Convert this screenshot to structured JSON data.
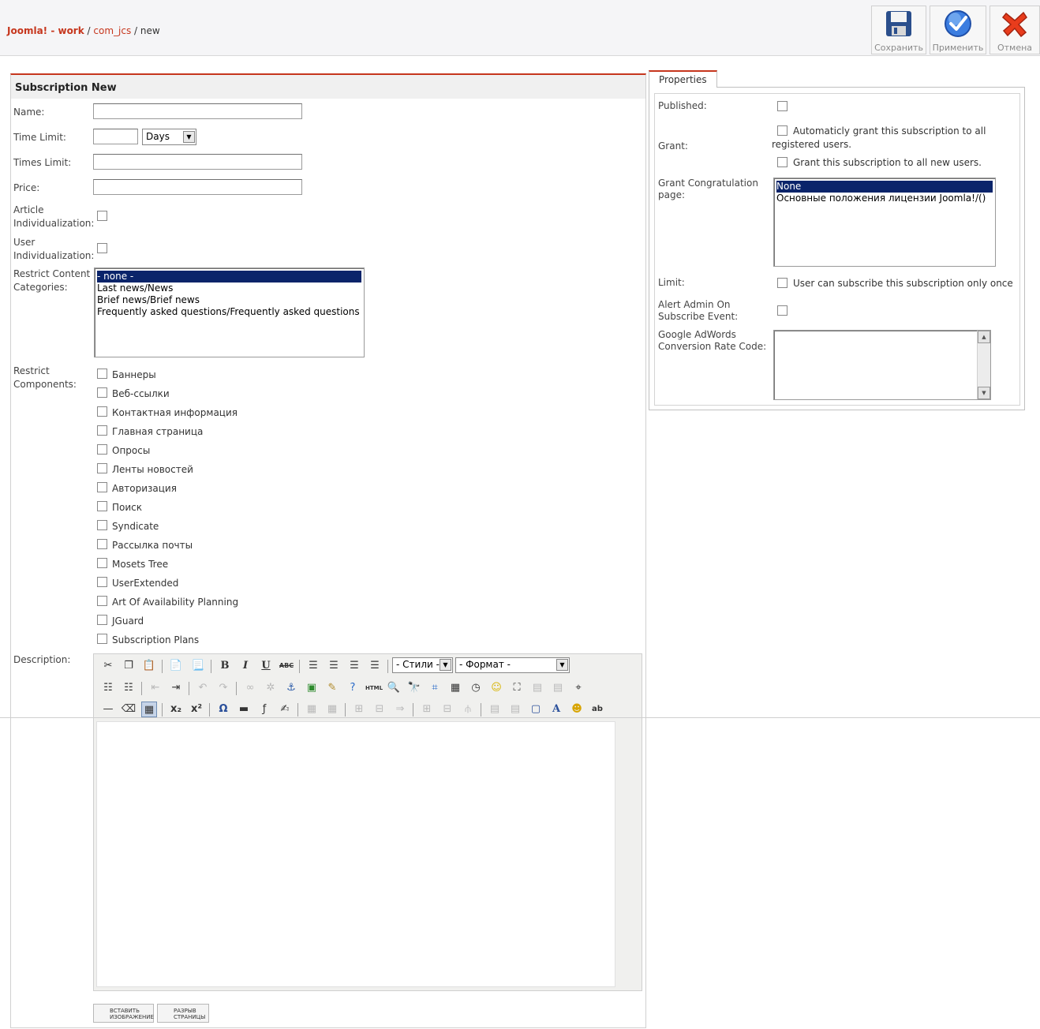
{
  "header": {
    "breadcrumb": {
      "site": "Joomla! - work",
      "sep1": " / ",
      "component": "com_jcs",
      "sep2": " / ",
      "page": "new"
    },
    "buttons": {
      "save": "Сохранить",
      "apply": "Применить",
      "cancel": "Отмена"
    }
  },
  "form": {
    "title": "Subscription New",
    "labels": {
      "name": "Name:",
      "time_limit": "Time Limit:",
      "times_limit": "Times Limit:",
      "price": "Price:",
      "article_ind": "Article Individualization:",
      "user_ind": "User Individualization:",
      "restrict_categories": "Restrict Content Categories:",
      "restrict_components": "Restrict Components:",
      "description": "Description:"
    },
    "time_unit": "Days",
    "categories": [
      "- none -",
      "Last news/News",
      "Brief news/Brief news",
      "Frequently asked questions/Frequently asked questions"
    ],
    "components": [
      "Баннеры",
      "Веб-ссылки",
      "Контактная информация",
      "Главная страница",
      "Опросы",
      "Ленты новостей",
      "Авторизация",
      "Поиск",
      "Syndicate",
      "Рассылка почты",
      "Mosets Tree",
      "UserExtended",
      "Art Of Availability Planning",
      "JGuard",
      "Subscription Plans"
    ],
    "editor": {
      "styles_select": "- Стили -",
      "format_select": "- Формат -",
      "html_label": "HTML",
      "insert_image": "ВСТАВИТЬ ИЗОБРАЖЕНИЕ",
      "page_break": "РАЗРЫВ СТРАНИЦЫ"
    }
  },
  "properties": {
    "tab": "Properties",
    "labels": {
      "published": "Published:",
      "grant": "Grant:",
      "congrats": "Grant Congratulation page:",
      "limit": "Limit:",
      "alert": "Alert Admin On Subscribe Event:",
      "adwords": "Google AdWords Conversion Rate Code:"
    },
    "grant_options": {
      "all_registered": "Automaticly grant this subscription to all registered users.",
      "all_new": "Grant this subscription to all new users."
    },
    "congrats_options": [
      "None",
      "Основные положения лицензии Joomla!/()"
    ],
    "limit_text": "User can subscribe this subscription only once"
  }
}
